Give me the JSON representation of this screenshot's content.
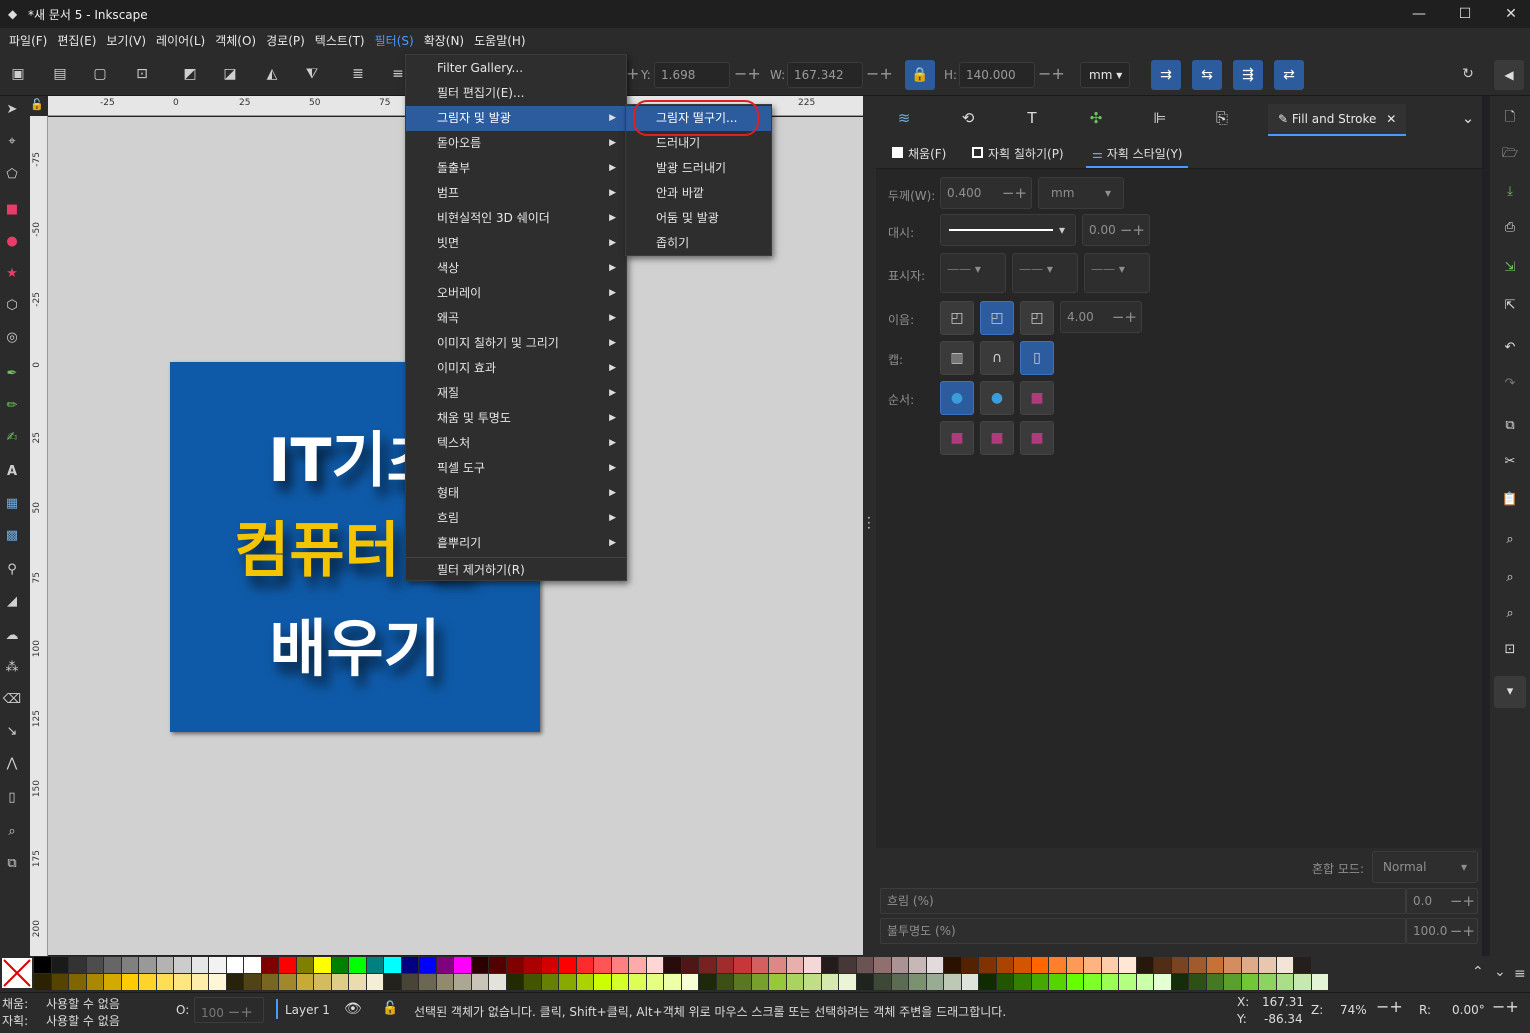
{
  "window": {
    "title": "*새 문서 5 - Inkscape",
    "minimize": "—",
    "maximize": "☐",
    "close": "✕"
  },
  "menubar": [
    "파일(F)",
    "편집(E)",
    "보기(V)",
    "레이어(L)",
    "객체(O)",
    "경로(P)",
    "텍스트(T)",
    "필터(S)",
    "확장(N)",
    "도움말(H)"
  ],
  "toolbar": {
    "y_label": "Y:",
    "y_value": "1.698",
    "w_label": "W:",
    "w_value": "167.342",
    "h_label": "H:",
    "h_value": "140.000",
    "unit": "mm"
  },
  "rulers": {
    "h": [
      "-25",
      "0",
      "25",
      "50",
      "75",
      "225"
    ],
    "v": [
      "-75",
      "-50",
      "-25",
      "0",
      "25",
      "50",
      "75",
      "100",
      "125",
      "150",
      "175",
      "200"
    ]
  },
  "artwork": {
    "line1": "IT기초",
    "line2": "컴퓨터 원",
    "line3": "배우기",
    "bg_color": "#0f5aa8",
    "accent_color": "#f5c400"
  },
  "filter_menu": {
    "items": [
      "Filter Gallery...",
      "필터 편집기(E)...",
      "그림자 및 발광",
      "돋아오름",
      "돌출부",
      "범프",
      "비현실적인 3D 쉐이더",
      "빗면",
      "색상",
      "오버레이",
      "왜곡",
      "이미지 칠하기 및 그리기",
      "이미지 효과",
      "재질",
      "채움 및 투명도",
      "텍스처",
      "픽셀 도구",
      "형태",
      "흐림",
      "흩뿌리기",
      "필터 제거하기(R)"
    ],
    "highlighted": "그림자 및 발광"
  },
  "submenu": {
    "items": [
      "그림자 떨구기...",
      "드러내기",
      "발광 드러내기",
      "안과 바깥",
      "어둠 및 발광",
      "좁히기"
    ],
    "highlighted": "그림자 떨구기..."
  },
  "panel": {
    "active_tab": "Fill and Stroke",
    "subtabs": [
      "채움(F)",
      "자획 칠하기(P)",
      "자획 스타일(Y)"
    ],
    "width_label": "두께(W):",
    "width_value": "0.400",
    "width_unit": "mm",
    "dash_label": "대시:",
    "dash_value": "0.00",
    "markers_label": "표시자:",
    "join_label": "이음:",
    "join_value": "4.00",
    "cap_label": "캡:",
    "order_label": "순서:",
    "blend_label": "혼합 모드:",
    "blend_value": "Normal",
    "blur_label": "흐림 (%)",
    "blur_value": "0.0",
    "opacity_label": "불투명도 (%)",
    "opacity_value": "100.0"
  },
  "status": {
    "fill_label": "채움:",
    "fill_value": "사용할 수 없음",
    "stroke_label": "자획:",
    "stroke_value": "사용할 수 없음",
    "o_label": "O:",
    "o_value": "100",
    "layer": "Layer 1",
    "message": "선택된 객체가 없습니다. 클릭, Shift+클릭, Alt+객체 위로 마우스 스크롤 또는 선택하려는 객체 주변을 드래그합니다.",
    "x_label": "X:",
    "x_value": "167.31",
    "y_label": "Y:",
    "y_value": "-86.34",
    "z_label": "Z:",
    "zoom": "74%",
    "r_label": "R:",
    "rotation": "0.00°"
  },
  "palette": {
    "row1": [
      "#000000",
      "#1a1a1a",
      "#333333",
      "#4d4d4d",
      "#666666",
      "#808080",
      "#999999",
      "#b3b3b3",
      "#cccccc",
      "#e6e6e6",
      "#f2f2f2",
      "#ffffff",
      "#ffffff",
      "#800000",
      "#ff0000",
      "#808000",
      "#ffff00",
      "#008000",
      "#00ff00",
      "#008080",
      "#00ffff",
      "#000080",
      "#0000ff",
      "#800080",
      "#ff00ff",
      "#2b0000",
      "#550000",
      "#800000",
      "#aa0000",
      "#d40000",
      "#ff0000",
      "#ff2a2a",
      "#ff5555",
      "#ff8080",
      "#ffaaaa",
      "#ffd5d5",
      "#280b0b",
      "#501616",
      "#782121",
      "#a02c2c",
      "#c83737",
      "#d35f5f",
      "#de8787",
      "#e9afaf",
      "#f4d7d7",
      "#241c1c",
      "#483737",
      "#6c5353",
      "#916f6f",
      "#ac9393",
      "#c8b7b7",
      "#e3dbdb",
      "#2b1100",
      "#552200",
      "#803300",
      "#aa4400",
      "#d45500",
      "#ff6600",
      "#ff7f2a",
      "#ff9955",
      "#ffb380",
      "#ffccaa",
      "#ffe6d5",
      "#28170b",
      "#502d16",
      "#784421",
      "#a05a2c",
      "#c87137",
      "#d38d5f",
      "#deaa87",
      "#e9c6af",
      "#f4e3d7",
      "#241f1c"
    ],
    "row2": [
      "#2b2200",
      "#554400",
      "#806600",
      "#aa8800",
      "#d4aa00",
      "#ffcc00",
      "#ffd42a",
      "#ffdd55",
      "#ffe680",
      "#ffeeaa",
      "#fff6d5",
      "#28220b",
      "#504416",
      "#786721",
      "#a0892c",
      "#c8ab37",
      "#d3bc5f",
      "#decd87",
      "#e9ddaf",
      "#f4eed7",
      "#24221c",
      "#484537",
      "#6c6753",
      "#918a6f",
      "#aca793",
      "#c8c4b7",
      "#e3e2db",
      "#222b00",
      "#445500",
      "#668000",
      "#88aa00",
      "#aad400",
      "#ccff00",
      "#d4ff2a",
      "#ddff55",
      "#e5ff80",
      "#eeffaa",
      "#f6ffd5",
      "#1e280b",
      "#3c5016",
      "#5a7821",
      "#78a02c",
      "#96c837",
      "#abd35f",
      "#c1de87",
      "#d6e9af",
      "#ebf4d7",
      "#1f241c",
      "#3e4837",
      "#5c6c53",
      "#7b916f",
      "#98ac93",
      "#bec8b7",
      "#dee3db",
      "#112b00",
      "#225500",
      "#338000",
      "#44aa00",
      "#55d400",
      "#66ff00",
      "#7fff2a",
      "#99ff55",
      "#b3ff80",
      "#ccffaa",
      "#e5ffd5",
      "#162d0b",
      "#2d5016",
      "#447821",
      "#5aa02c",
      "#71c837",
      "#8dd35f",
      "#aade87",
      "#c6e9af",
      "#e3f4d7"
    ]
  }
}
